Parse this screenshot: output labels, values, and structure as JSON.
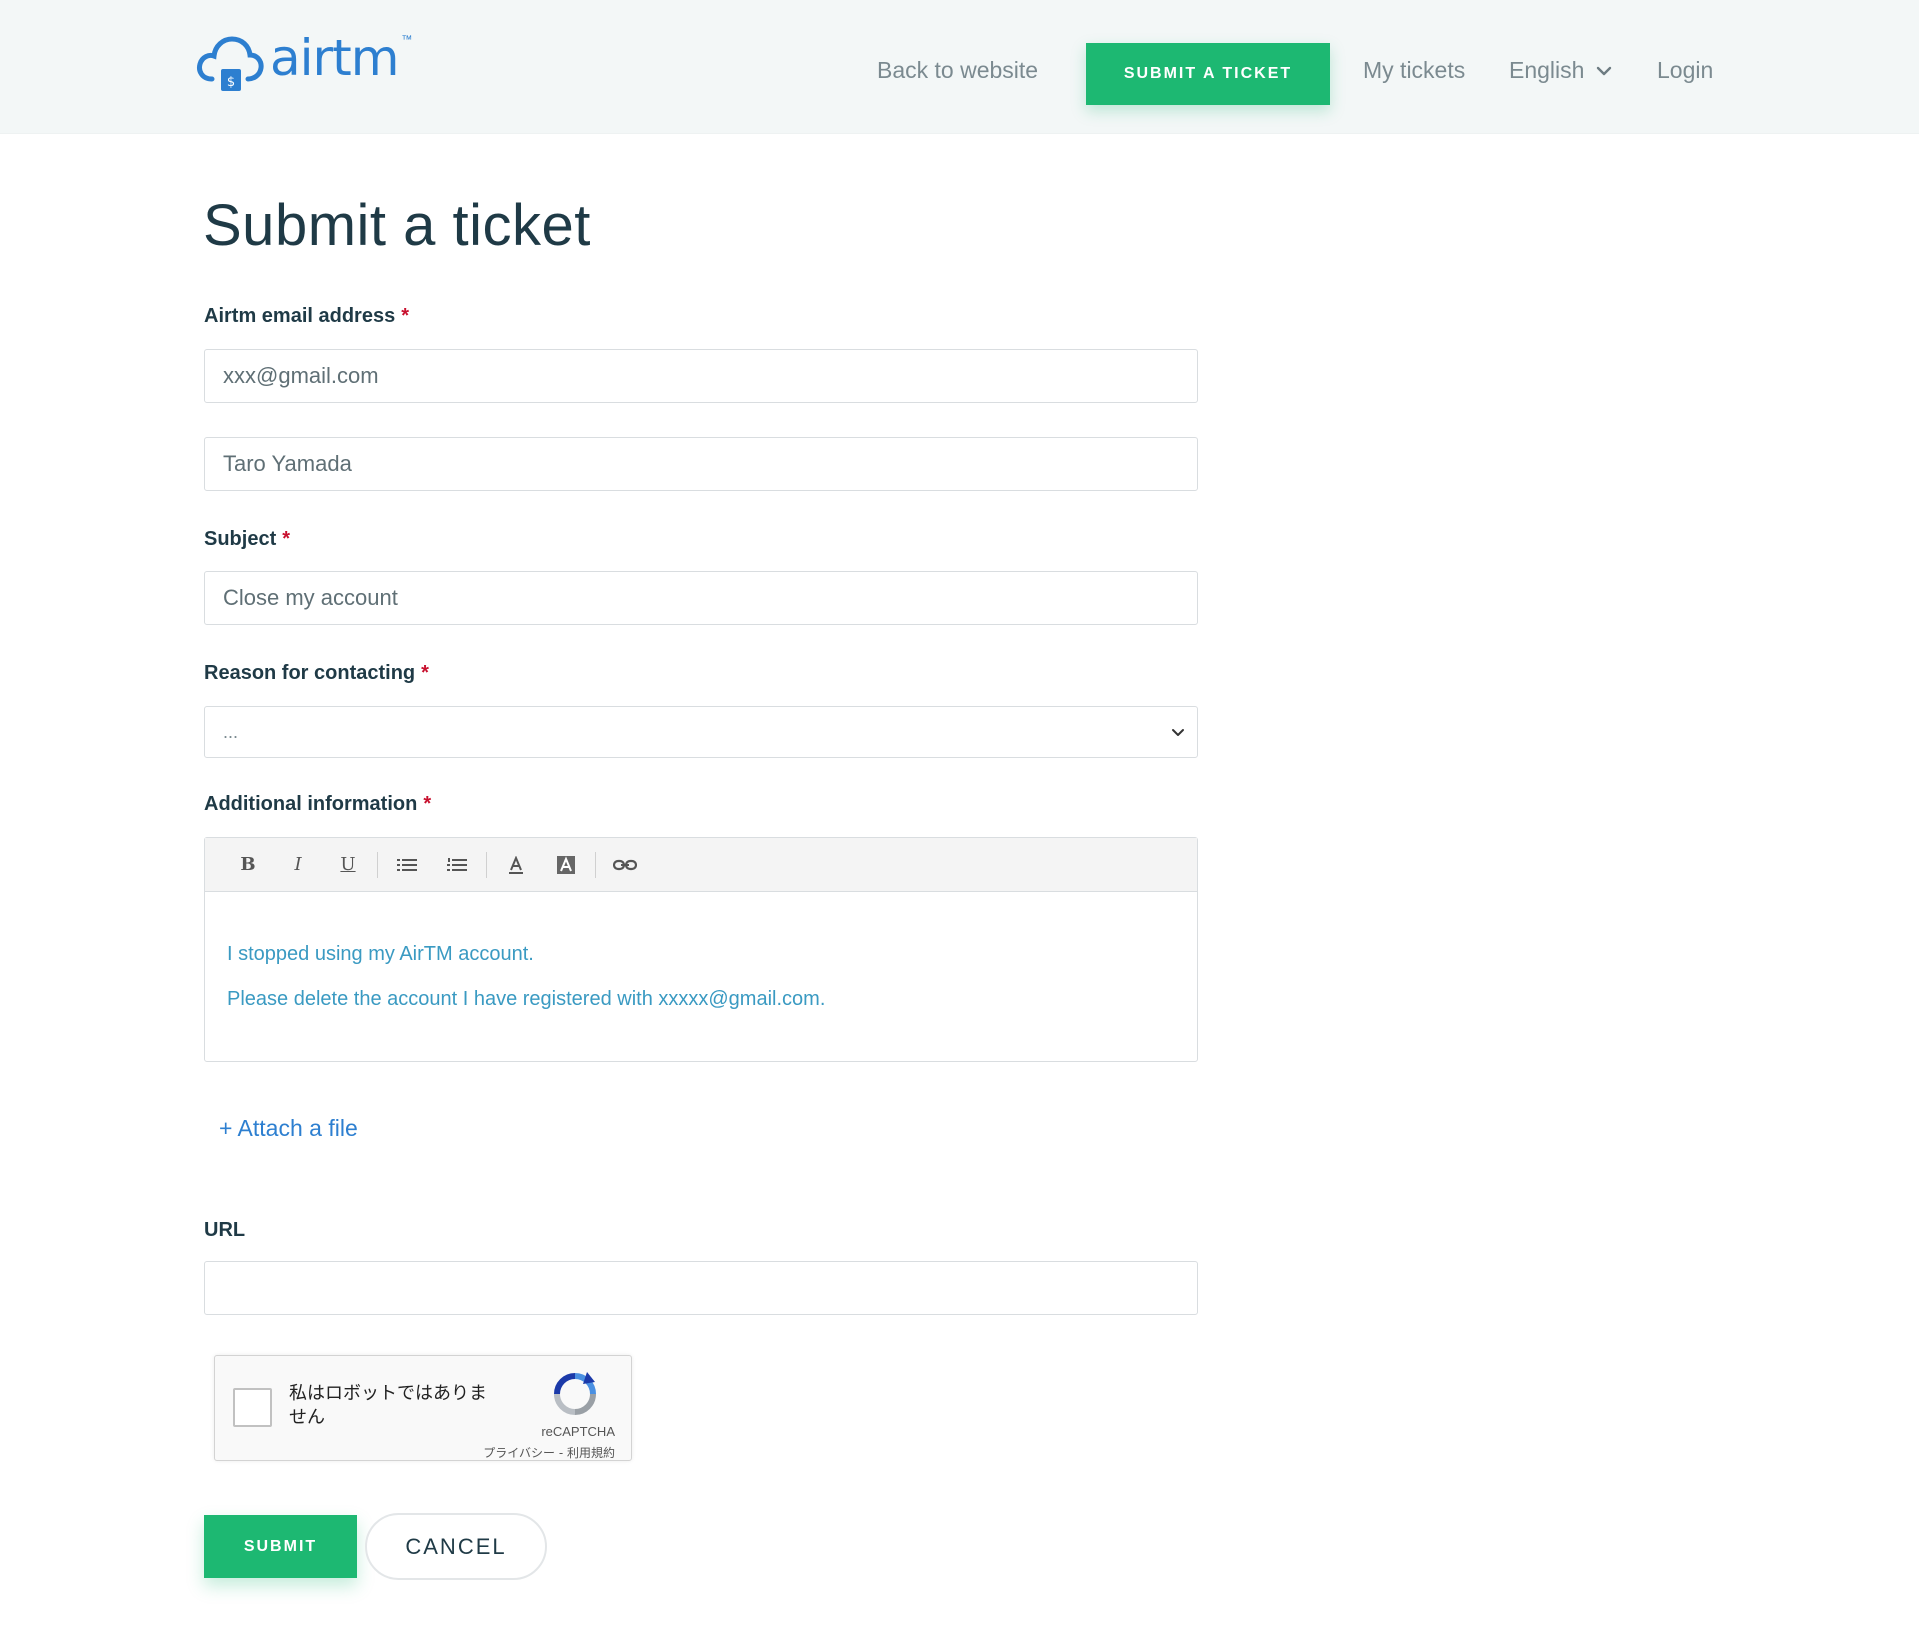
{
  "header": {
    "logo_text": "airtm",
    "logo_tm": "™",
    "back_to_website": "Back to website",
    "submit_ticket": "SUBMIT A TICKET",
    "my_tickets": "My tickets",
    "language": "English",
    "login": "Login"
  },
  "form": {
    "title": "Submit a ticket",
    "email_label": "Airtm email address",
    "email_value": "xxx@gmail.com",
    "name_value": "Taro Yamada",
    "subject_label": "Subject",
    "subject_value": "Close my account",
    "reason_label": "Reason for contacting",
    "reason_value": "...",
    "additional_label": "Additional information",
    "additional_lines": [
      "I stopped using my AirTM account.",
      "Please delete the account I have registered with xxxxx@gmail.com."
    ],
    "attach_label": "+ Attach a file",
    "url_label": "URL",
    "url_value": "",
    "required_marker": "*"
  },
  "toolbar": {
    "bold": "B",
    "italic": "I",
    "underline": "U"
  },
  "captcha": {
    "text": "私はロボットではありません",
    "brand": "reCAPTCHA",
    "links": "プライバシー - 利用規約"
  },
  "buttons": {
    "submit": "SUBMIT",
    "cancel": "CANCEL"
  },
  "colors": {
    "accent": "#1db872",
    "link": "#2d7fd0",
    "required": "#c8102e",
    "editor_text": "#3a9ac2"
  }
}
